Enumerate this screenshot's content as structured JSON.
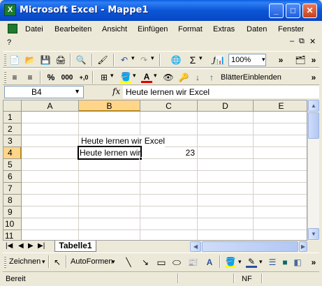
{
  "window": {
    "title": "Microsoft Excel - Mappe1",
    "app_icon_glyph": "X"
  },
  "menu": {
    "items": [
      "Datei",
      "Bearbeiten",
      "Ansicht",
      "Einfügen",
      "Format",
      "Extras",
      "Daten",
      "Fenster",
      "?"
    ]
  },
  "toolbar": {
    "zoom": "100%",
    "custom_button_label": "BlätterEinblenden"
  },
  "formula_bar": {
    "name_box": "B4",
    "fx_label": "fx",
    "content": "Heute lernen wir Excel"
  },
  "sheet": {
    "columns": [
      "A",
      "B",
      "C",
      "D",
      "E"
    ],
    "rows": [
      "1",
      "2",
      "3",
      "4",
      "5",
      "6",
      "7",
      "8",
      "9",
      "10",
      "11"
    ],
    "active_column": "B",
    "active_row": "4",
    "cells": {
      "B3": "Heute lernen wir Excel",
      "B4": "Heute lernen wir Excel",
      "C4": "23"
    }
  },
  "sheet_tabs": [
    "Tabelle1"
  ],
  "drawing_toolbar": {
    "draw_label": "Zeichnen",
    "autoshapes_label": "AutoFormen"
  },
  "status": {
    "left": "Bereit",
    "indicator": "NF"
  },
  "colors": {
    "titlebar": "#0b56d6",
    "active_header": "#ffd58a",
    "chrome": "#ece9d8"
  }
}
